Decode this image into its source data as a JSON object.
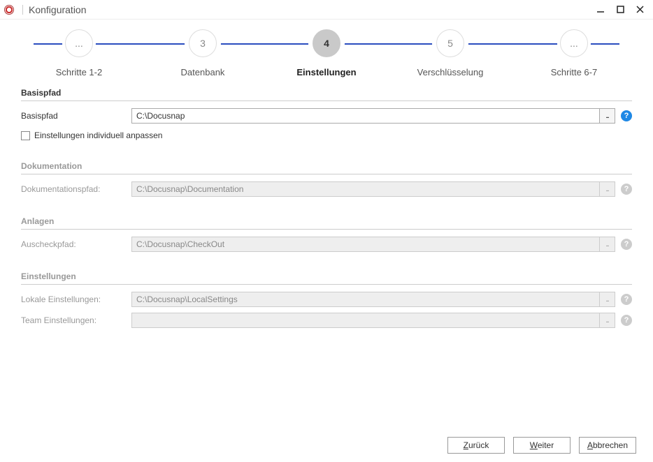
{
  "window": {
    "title": "Konfiguration"
  },
  "stepper": {
    "steps": [
      {
        "circle": "...",
        "label": "Schritte 1-2"
      },
      {
        "circle": "3",
        "label": "Datenbank"
      },
      {
        "circle": "4",
        "label": "Einstellungen"
      },
      {
        "circle": "5",
        "label": "Verschlüsselung"
      },
      {
        "circle": "...",
        "label": "Schritte 6-7"
      }
    ],
    "activeIndex": 2
  },
  "sections": {
    "basispfad": {
      "title": "Basispfad",
      "field_label": "Basispfad",
      "field_value": "C:\\Docusnap",
      "browse": "...",
      "checkbox_label": "Einstellungen individuell anpassen"
    },
    "dokumentation": {
      "title": "Dokumentation",
      "field_label": "Dokumentationspfad:",
      "field_value": "C:\\Docusnap\\Documentation",
      "browse": "..."
    },
    "anlagen": {
      "title": "Anlagen",
      "field_label": "Auscheckpfad:",
      "field_value": "C:\\Docusnap\\CheckOut",
      "browse": "..."
    },
    "einstellungen": {
      "title": "Einstellungen",
      "lokale_label": "Lokale Einstellungen:",
      "lokale_value": "C:\\Docusnap\\LocalSettings",
      "team_label": "Team Einstellungen:",
      "team_value": "",
      "browse": "..."
    }
  },
  "footer": {
    "back_prefix": "Z",
    "back_rest": "urück",
    "next_prefix": "W",
    "next_rest": "eiter",
    "cancel_prefix": "A",
    "cancel_rest": "bbrechen"
  },
  "icons": {
    "help": "?"
  }
}
